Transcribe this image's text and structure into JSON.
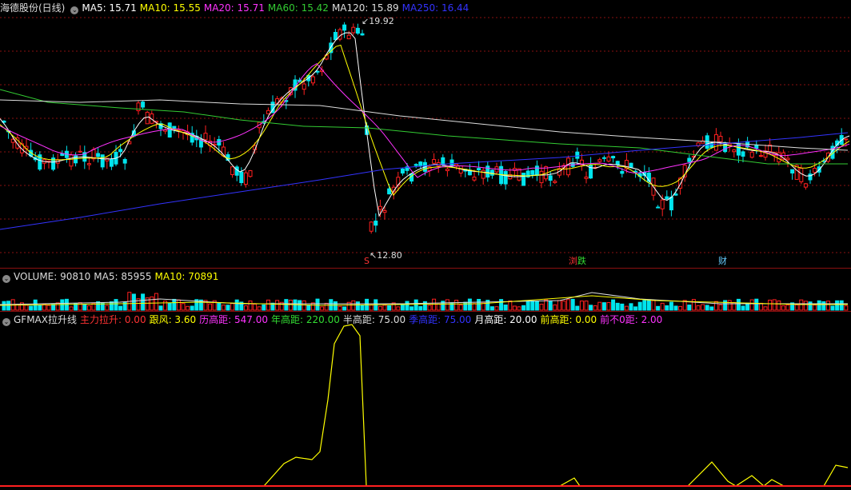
{
  "price_panel": {
    "stock_name": "海德股份(日线)",
    "ma": [
      {
        "label": "MA5: 15.71",
        "color": "#ffffff"
      },
      {
        "label": "MA10: 15.55",
        "color": "#ffff00"
      },
      {
        "label": "MA20: 15.71",
        "color": "#ff33ff"
      },
      {
        "label": "MA60: 15.42",
        "color": "#33cc33"
      },
      {
        "label": "MA120: 15.89",
        "color": "#dddddd"
      },
      {
        "label": "MA250: 16.44",
        "color": "#3333ff"
      }
    ],
    "high_label": "19.92",
    "low_label": "12.80",
    "markers": {
      "s": "S",
      "liu": "浏",
      "die": "跌",
      "cai": "财"
    }
  },
  "volume_panel": {
    "items": [
      {
        "label": "VOLUME: 90810",
        "color": "#dddddd"
      },
      {
        "label": "MA5: 85955",
        "color": "#dddddd"
      },
      {
        "label": "MA10: 70891",
        "color": "#ffff00"
      }
    ]
  },
  "indicator_panel": {
    "name": "GFMAX拉升线",
    "items": [
      {
        "label": "主力拉升: 0.00",
        "color": "#ff3333"
      },
      {
        "label": "跟风: 3.60",
        "color": "#ffff00"
      },
      {
        "label": "历高距: 547.00",
        "color": "#ff33ff"
      },
      {
        "label": "年高距: 220.00",
        "color": "#33dd33"
      },
      {
        "label": "半高距: 75.00",
        "color": "#dddddd"
      },
      {
        "label": "季高距: 75.00",
        "color": "#3333ff"
      },
      {
        "label": "月高距: 20.00",
        "color": "#ffffff"
      },
      {
        "label": "前高距: 0.00",
        "color": "#ffff00"
      },
      {
        "label": "前不0距: 2.00",
        "color": "#ff33ff"
      }
    ]
  },
  "colors": {
    "up": "#ff2020",
    "down": "#00e5ee",
    "grid": "#8a1010"
  }
}
